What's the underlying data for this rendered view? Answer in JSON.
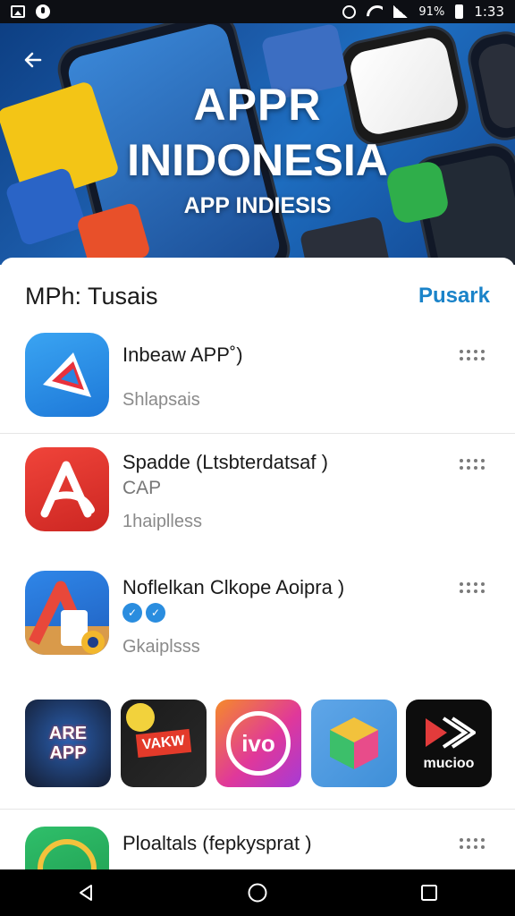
{
  "status_bar": {
    "battery_percent": "91%",
    "time": "1:33"
  },
  "hero": {
    "title_line1": "APPR",
    "title_line2": "INIDONESIA",
    "subtitle": "APP INDIESIS"
  },
  "section": {
    "title": "MPh: Tusais",
    "action": "Pusark"
  },
  "apps": [
    {
      "name": "Inbeaw APP˚)",
      "category": "",
      "subtitle": "Shlapsais"
    },
    {
      "name": "Spadde (Ltsbterdatsaf )",
      "category": "CAP",
      "subtitle": "1haiplless"
    },
    {
      "name": "Noflelkan Clkope Aoipra )",
      "category": "",
      "subtitle": "Gkaiplsss"
    },
    {
      "name": "Ploaltals (fepkysprat )",
      "category": "",
      "subtitle": ""
    }
  ],
  "featured": [
    {
      "label": "ARE APP",
      "bg": "#1b2a4a"
    },
    {
      "label": "VAKW",
      "bg": "#141414"
    },
    {
      "label": "ivo",
      "bg": "#e0389a"
    },
    {
      "label": "",
      "bg": "#3f8fd8"
    },
    {
      "label": "mucioo",
      "bg": "#0d0d0d"
    }
  ],
  "colors": {
    "accent": "#1a83c9",
    "hero_bg": "#1b5aa8",
    "app1_icon": "#2f8fe6",
    "app2_icon": "#e0332c",
    "app3_icon": "#2d6fd1"
  },
  "icons": {
    "status_left": [
      "gallery-icon",
      "face-icon"
    ],
    "status_right": [
      "alarm-icon",
      "wifi-icon",
      "signal-icon",
      "battery-icon"
    ],
    "nav": [
      "back-triangle-icon",
      "home-circle-icon",
      "recents-square-icon"
    ],
    "hero_back": "arrow-left-icon",
    "row_more": "more-dots-icon"
  }
}
